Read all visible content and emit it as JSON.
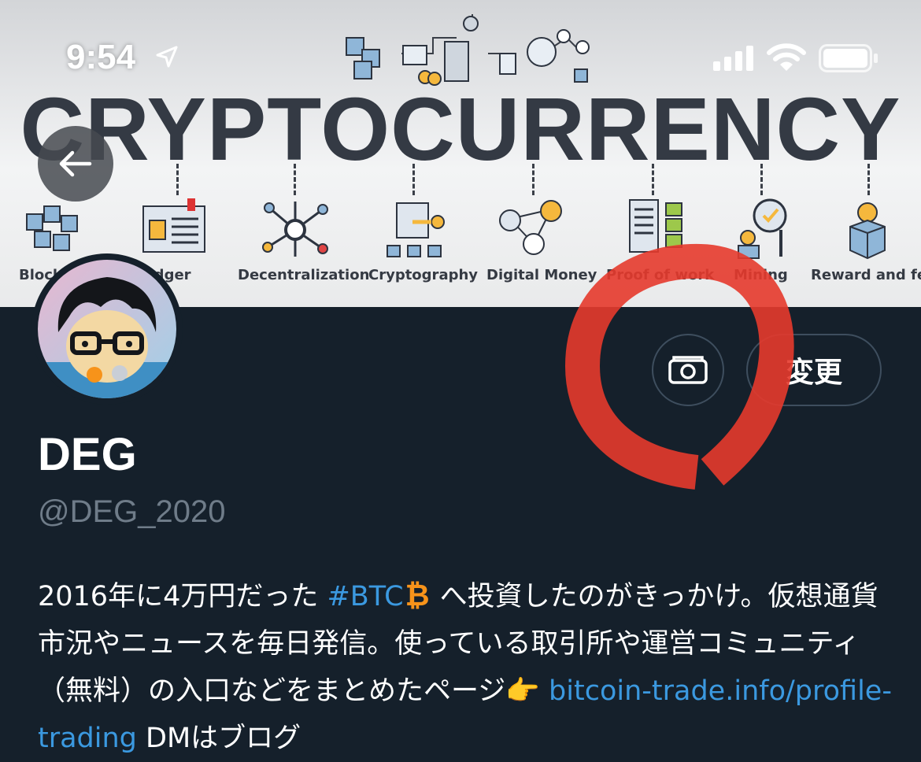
{
  "status_bar": {
    "time": "9:54",
    "location_icon": "location-arrow-icon",
    "signal_icon": "cellular-signal-icon",
    "wifi_icon": "wifi-icon",
    "battery_icon": "battery-icon"
  },
  "banner": {
    "title": "CRYPTOCURRENCY",
    "labels": [
      "Block",
      "Ledger",
      "Decentralization",
      "Cryptography",
      "Digital Money",
      "Proof of work",
      "Mining",
      "Reward and fee"
    ]
  },
  "header": {
    "back_icon": "back-arrow-icon",
    "change_photo_icon": "camera-icon",
    "change_label": "変更"
  },
  "profile": {
    "name": "DEG",
    "handle": "@DEG_2020",
    "bio": {
      "p1": "2016年に4万円だった ",
      "hashtag": "#BTC",
      "btc_symbol": "₿",
      "p2": " へ投資したのがきっかけ。仮想通貨市況やニュースを毎日発信。使っている取引所や運営コミュニティ（無料）の入口などをまとめたページ",
      "pointer_emoji": "👉",
      "link": "bitcoin-trade.info/profile-trading",
      "p3": " DMはブログ"
    }
  },
  "colors": {
    "background": "#15202b",
    "accent": "#3b99e0",
    "annotation": "#e53a2c"
  }
}
